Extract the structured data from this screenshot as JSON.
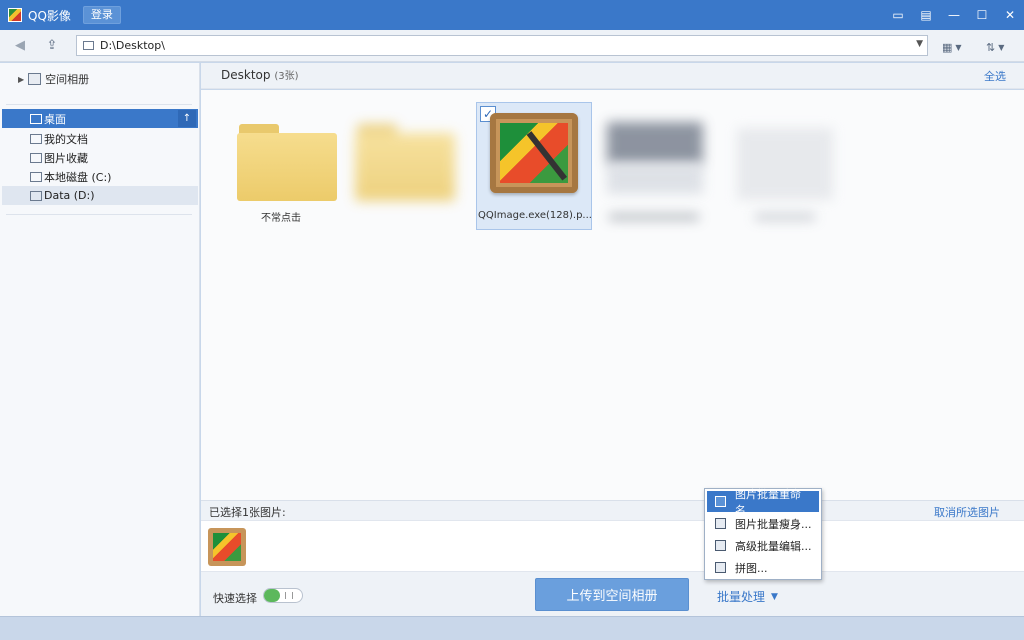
{
  "window": {
    "title": "QQ影像",
    "login_label": "登录",
    "controls": [
      "feedback-icon",
      "skin-icon",
      "minimize-icon",
      "maximize-icon",
      "close-icon"
    ]
  },
  "addressbar": {
    "path": "D:\\Desktop\\",
    "view_mode_icon": "grid-view-icon",
    "sort_icon": "sort-icon"
  },
  "sidebar": {
    "root_label": "空间相册",
    "items": [
      {
        "label": "桌面",
        "icon": "desktop-icon",
        "state": "selected"
      },
      {
        "label": "我的文档",
        "icon": "document-icon",
        "state": ""
      },
      {
        "label": "图片收藏",
        "icon": "picture-icon",
        "state": ""
      },
      {
        "label": "本地磁盘 (C:)",
        "icon": "drive-icon",
        "state": ""
      },
      {
        "label": "Data (D:)",
        "icon": "drive-icon",
        "state": "hover"
      }
    ]
  },
  "main": {
    "title": "Desktop",
    "count": "(3张)",
    "select_all": "全选",
    "thumbnails": [
      {
        "caption": "不常点击",
        "type": "folder"
      },
      {
        "caption": "",
        "type": "folder-blurred"
      },
      {
        "caption": "QQImage.exe(128).p...",
        "type": "image",
        "selected": true
      },
      {
        "caption": "",
        "type": "blurred"
      },
      {
        "caption": "",
        "type": "blurred"
      }
    ]
  },
  "selection": {
    "label": "已选择1张图片:",
    "cancel": "取消所选图片"
  },
  "bottom": {
    "quick_select": "快速选择",
    "toggle_on": true,
    "upload": "上传到空间相册",
    "batch": "批量处理"
  },
  "menu": {
    "items": [
      {
        "label": "图片批量重命名...",
        "icon": "rename-icon",
        "active": true
      },
      {
        "label": "图片批量瘦身...",
        "icon": "compress-icon",
        "active": false
      },
      {
        "label": "高级批量编辑...",
        "icon": "batch-edit-icon",
        "active": false
      },
      {
        "label": "拼图...",
        "icon": "collage-icon",
        "active": false
      }
    ]
  }
}
